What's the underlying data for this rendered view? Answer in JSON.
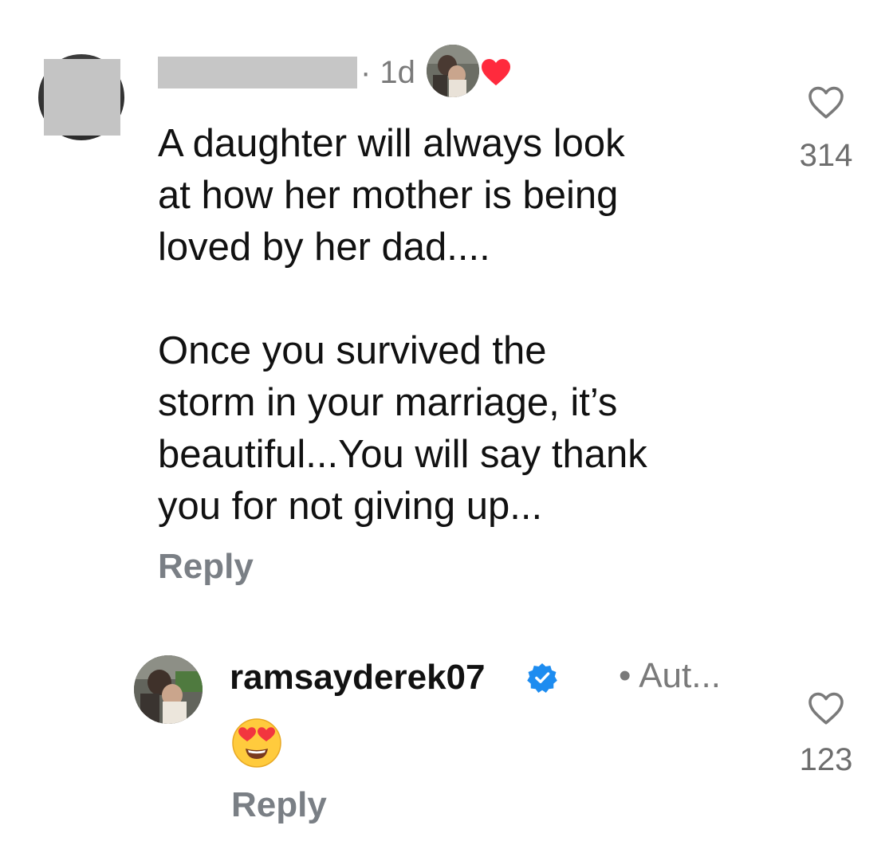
{
  "comment": {
    "time": "· 1d",
    "paragraph_1": "A daughter will always look\nat how her mother is being\nloved by her dad....",
    "paragraph_2": "Once you survived the\nstorm in your marriage, it’s\nbeautiful...You will say thank\nyou for not giving up...",
    "reply_label": "Reply",
    "like_count": "314",
    "liked_by_author": true
  },
  "reply": {
    "username": "ramsayderek07",
    "verified": true,
    "meta": "• Aut...",
    "emoji": "heart-eyes-emoji",
    "reply_label": "Reply",
    "like_count": "123"
  },
  "icons": {
    "like": "heart-outline-icon",
    "author_like": "heart-filled-icon",
    "verified": "verified-badge-icon"
  },
  "colors": {
    "heart_red": "#ff2a3d",
    "verified_blue": "#1d8cf0",
    "secondary_text": "#7a7f85",
    "primary_text": "#111111",
    "emoji_yellow": "#ffcb3d"
  }
}
